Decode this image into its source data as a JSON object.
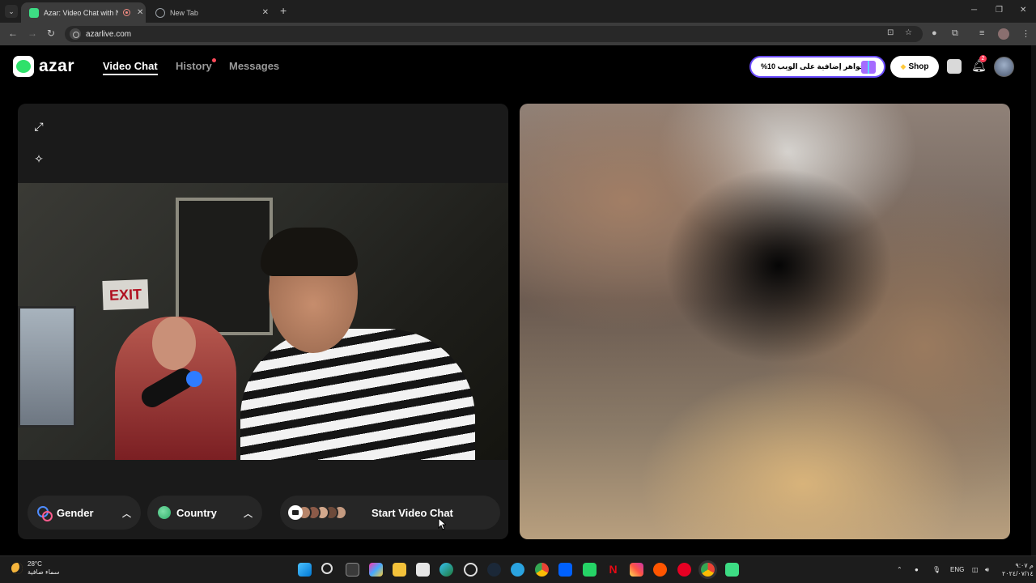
{
  "browser": {
    "tabs": [
      {
        "title": "Azar: Video Chat with New",
        "active": true
      },
      {
        "title": "New Tab",
        "active": false
      }
    ],
    "new_tab_label": "+",
    "url": "azarlive.com"
  },
  "header": {
    "logo": "azar",
    "nav": [
      {
        "label": "Video Chat",
        "active": true
      },
      {
        "label": "History",
        "active": false,
        "has_dot": true
      },
      {
        "label": "Messages",
        "active": false
      }
    ],
    "promo_text": "اجواهر إضافية على الويب 10%",
    "shop_label": "Shop",
    "notification_count": "2"
  },
  "controls": {
    "gender_label": "Gender",
    "country_label": "Country",
    "start_label": "Start Video Chat"
  },
  "taskbar": {
    "temperature": "28°C",
    "weather_desc": "سماء صافية",
    "lang": "ENG",
    "time": "م ٩:٠٧",
    "date": "٢٠٢٤/٠٧/١٤"
  },
  "colors": {
    "brand_green": "#2ee16a",
    "background": "#000000",
    "panel": "#1a1a1a",
    "pill": "#262626"
  }
}
